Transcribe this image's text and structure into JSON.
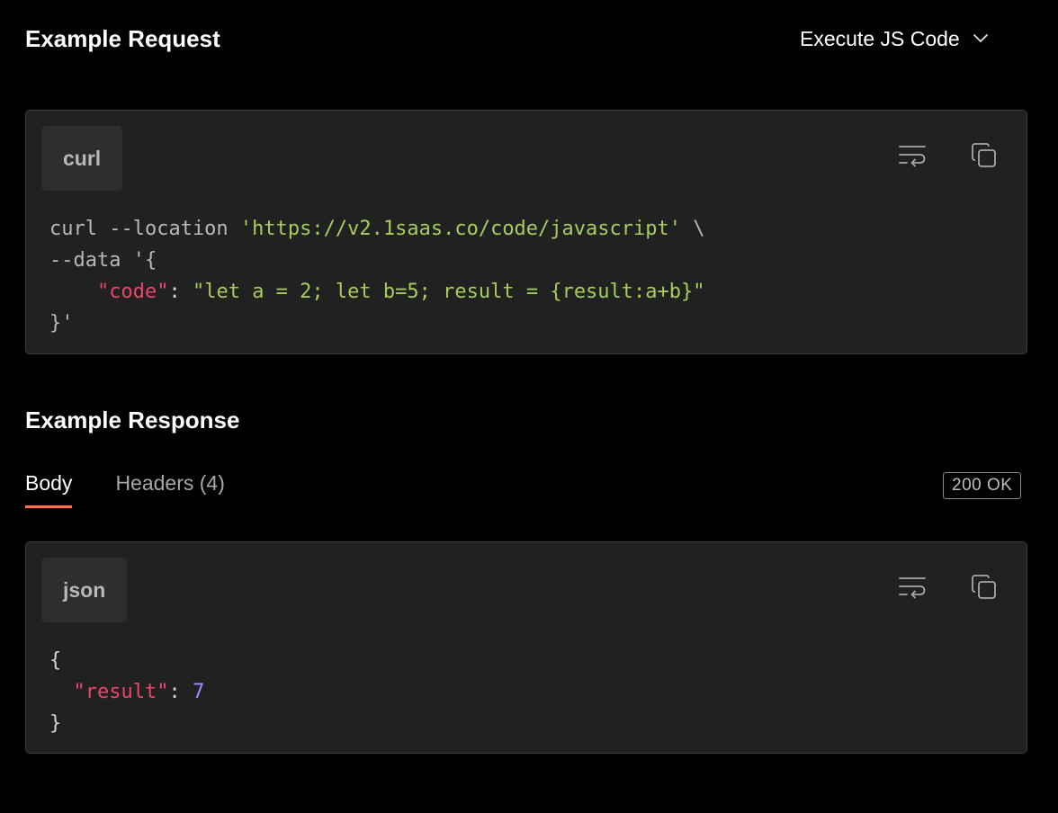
{
  "request": {
    "title": "Example Request",
    "selector_label": "Execute JS Code",
    "language": "curl",
    "code_tokens": {
      "cmd": "curl --location ",
      "url": "'https://v2.1saas.co/code/javascript'",
      "cont": " \\",
      "data_flag": "--data '{",
      "indent": "    ",
      "key": "\"code\"",
      "colon": ": ",
      "value": "\"let a = 2; let b=5; result = {result:a+b}\"",
      "close": "}'"
    }
  },
  "response": {
    "title": "Example Response",
    "tabs": [
      {
        "label": "Body",
        "active": true
      },
      {
        "label": "Headers (4)",
        "active": false
      }
    ],
    "status": "200 OK",
    "language": "json",
    "code_tokens": {
      "open": "{",
      "indent": "  ",
      "key": "\"result\"",
      "colon": ": ",
      "value": "7",
      "close": "}"
    }
  },
  "icons": {
    "wrap": "wrap-lines-icon",
    "copy": "copy-icon",
    "dropdown": "chevron-down-icon"
  },
  "colors": {
    "accent": "#ee7a4a",
    "string": "#a7cc5a",
    "key": "#e8466d",
    "number": "#a78bfa"
  }
}
